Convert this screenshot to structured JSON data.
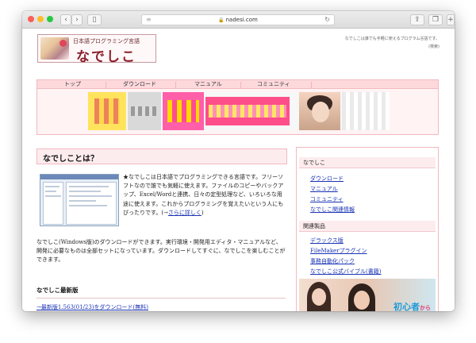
{
  "browser": {
    "url": "nadesi.com"
  },
  "header": {
    "logo_sub": "日本語プログラミング言語",
    "logo_main": "なでしこ",
    "tagline": "なでしこは誰でも手軽に使えるプログラム言語です。",
    "tagline_en": "(検索)"
  },
  "nav": {
    "items": [
      {
        "label": "トップ"
      },
      {
        "label": "ダウンロード"
      },
      {
        "label": "マニュアル"
      },
      {
        "label": "コミュニティ"
      }
    ]
  },
  "main": {
    "title": "なでしことは？",
    "intro": "★なでしこは日本語でプログラミングできる言語です。フリーソフトなので誰でも気軽に使えます。ファイルのコピーやバックアップ、Excel/Wordと連携、日々の定型処理など、いろいろな用途に使えます。これからプログラミングを覚えたいという人にもぴったりです。",
    "more_prefix": "(→",
    "more_link": "さらに詳しく",
    "more_suffix": ")",
    "paragraph": "なでしこ(Windows版)のダウンロードができます。実行環境・開発用エディタ・マニュアルなど、開発に必要なものは全部セットになっています。ダウンロードしてすぐに、なでしこを楽しむことができます。",
    "latest_heading": "なでしこ最新版",
    "latest_link": "→最新版1.563(01/23)をダウンロード(無料)"
  },
  "sidebar": {
    "section1_title": "なでしこ",
    "section1_links": [
      {
        "label": "ダウンロード"
      },
      {
        "label": "マニュアル"
      },
      {
        "label": "コミュニティ"
      },
      {
        "label": "なでしこ関連情報"
      }
    ],
    "section2_title": "関連製品",
    "section2_links": [
      {
        "label": "デラックス版"
      },
      {
        "label": "FileMakerプラグイン"
      },
      {
        "label": "事務自動化パック"
      },
      {
        "label": "なでしこ公式バイブル(書籍)"
      }
    ],
    "ad_text": "初心者",
    "ad_small": "から"
  }
}
